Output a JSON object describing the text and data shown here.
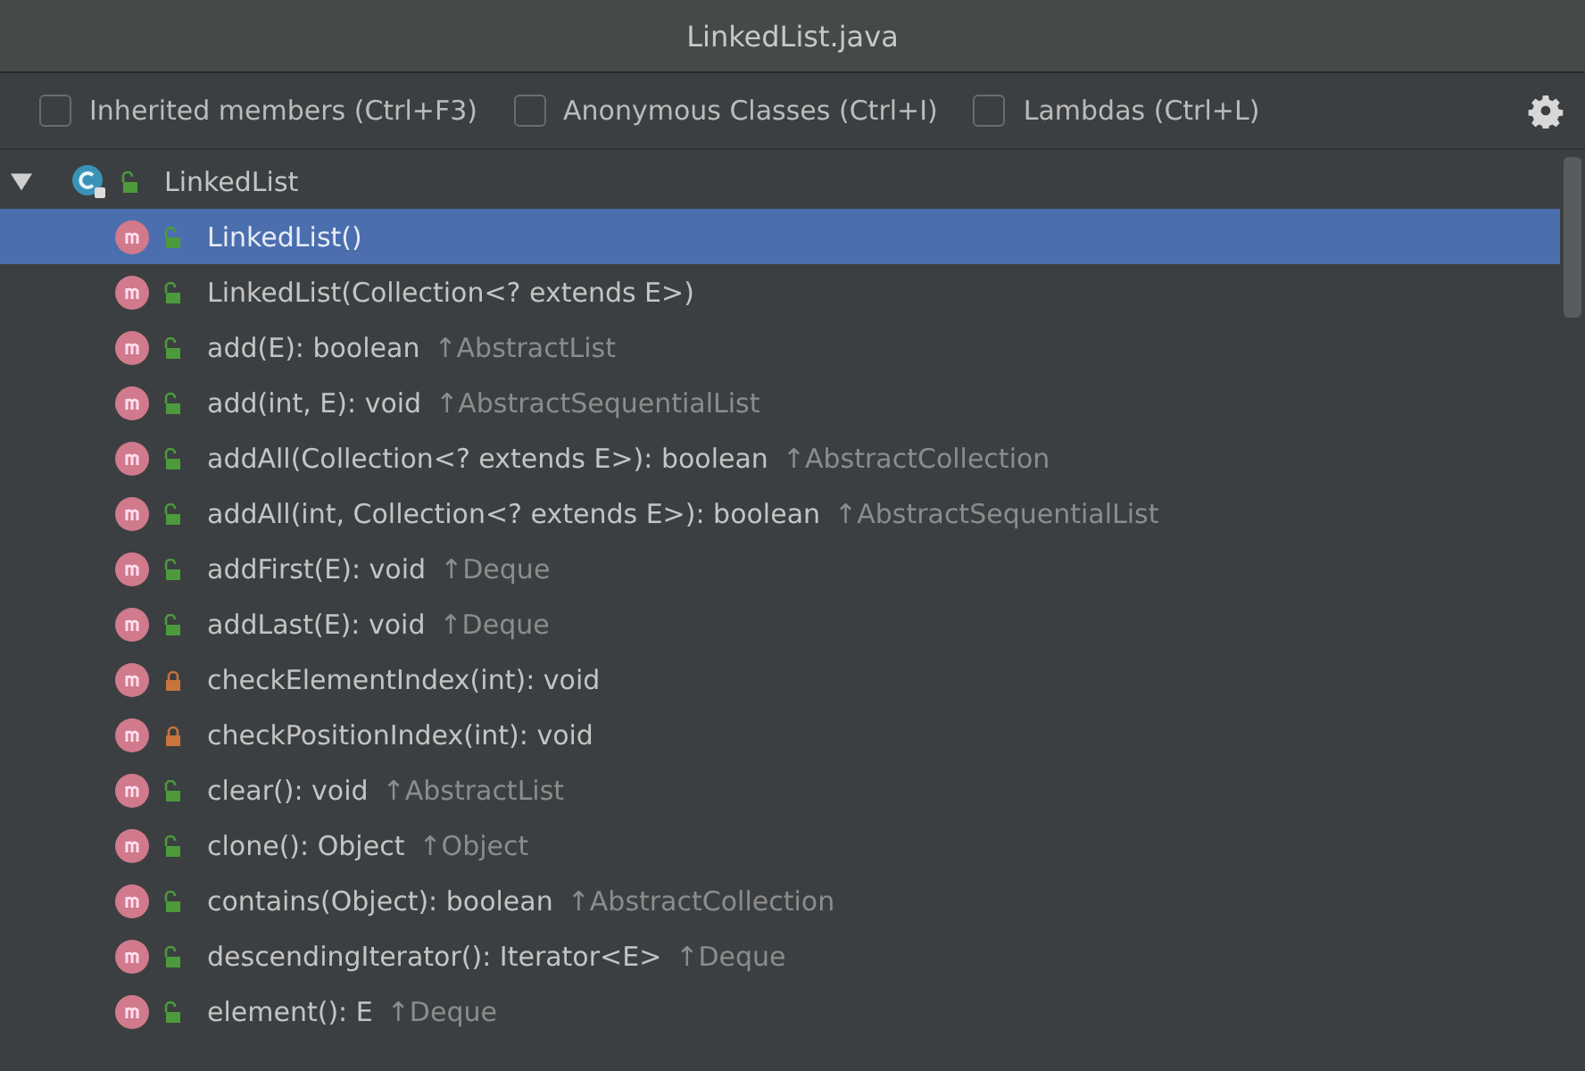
{
  "window": {
    "title": "LinkedList.java"
  },
  "filters": [
    {
      "label": "Inherited members (Ctrl+F3)",
      "checked": false
    },
    {
      "label": "Anonymous Classes (Ctrl+I)",
      "checked": false
    },
    {
      "label": "Lambdas (Ctrl+L)",
      "checked": false
    }
  ],
  "tree": {
    "label": "LinkedList",
    "expanded": true,
    "kind": "public",
    "children": [
      {
        "signature": "LinkedList()",
        "kind": "public",
        "selected": true
      },
      {
        "signature": "LinkedList(Collection<? extends E>)",
        "kind": "public",
        "selected": false
      },
      {
        "signature": "add(E): boolean",
        "origin": "↑AbstractList",
        "kind": "public",
        "selected": false
      },
      {
        "signature": "add(int, E): void",
        "origin": "↑AbstractSequentialList",
        "kind": "public",
        "selected": false
      },
      {
        "signature": "addAll(Collection<? extends E>): boolean",
        "origin": "↑AbstractCollection",
        "kind": "public",
        "selected": false
      },
      {
        "signature": "addAll(int, Collection<? extends E>): boolean",
        "origin": "↑AbstractSequentialList",
        "kind": "public",
        "selected": false
      },
      {
        "signature": "addFirst(E): void",
        "origin": "↑Deque",
        "kind": "public",
        "selected": false
      },
      {
        "signature": "addLast(E): void",
        "origin": "↑Deque",
        "kind": "public",
        "selected": false
      },
      {
        "signature": "checkElementIndex(int): void",
        "kind": "private",
        "selected": false
      },
      {
        "signature": "checkPositionIndex(int): void",
        "kind": "private",
        "selected": false
      },
      {
        "signature": "clear(): void",
        "origin": "↑AbstractList",
        "kind": "public",
        "selected": false
      },
      {
        "signature": "clone(): Object",
        "origin": "↑Object",
        "kind": "public",
        "selected": false
      },
      {
        "signature": "contains(Object): boolean",
        "origin": "↑AbstractCollection",
        "kind": "public",
        "selected": false
      },
      {
        "signature": "descendingIterator(): Iterator<E>",
        "origin": "↑Deque",
        "kind": "public",
        "selected": false
      },
      {
        "signature": "element(): E",
        "origin": "↑Deque",
        "kind": "public",
        "selected": false
      }
    ]
  }
}
